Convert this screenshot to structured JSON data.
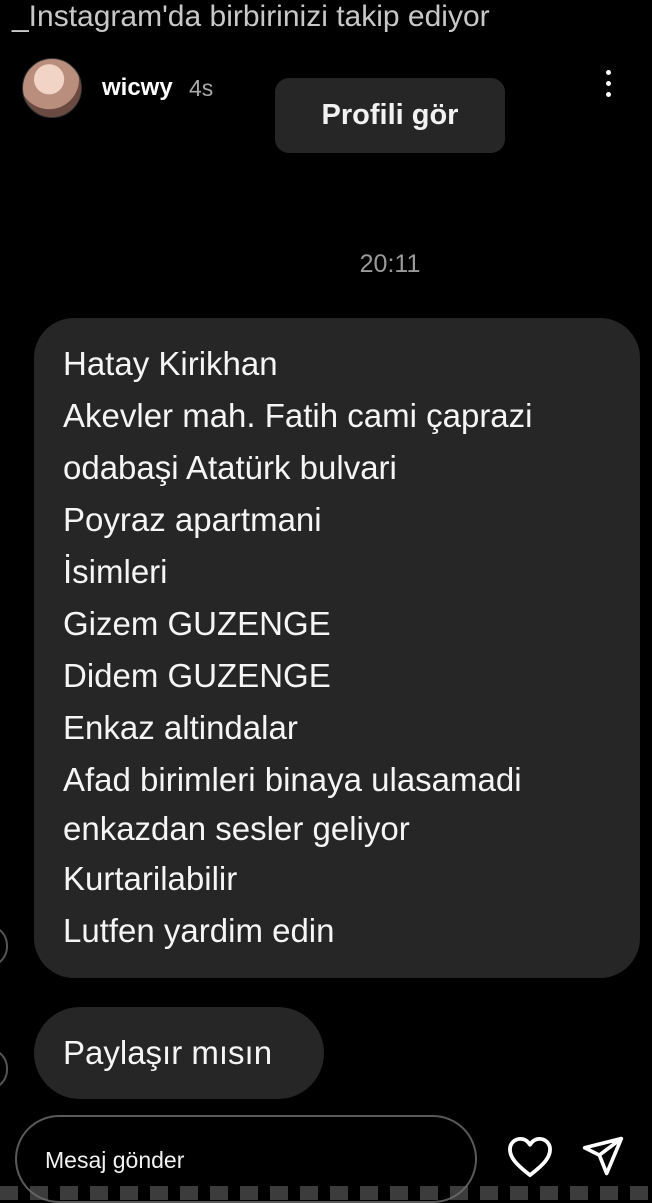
{
  "top_banner": {
    "text": "_Instagram'da birbirinizi takip ediyor"
  },
  "header": {
    "username": "wicwy",
    "time_ago": "4s",
    "more_icon": "more-vertical-icon",
    "profile_button": "Profili gör"
  },
  "chat": {
    "timestamp": "20:11",
    "message_lines": [
      "Hatay Kirikhan",
      "Akevler mah. Fatih cami çaprazi",
      "odabaşi Atatürk bulvari",
      "Poyraz apartmani",
      "İsimleri",
      "Gizem GUZENGE",
      "Didem GUZENGE",
      "Enkaz altindalar",
      "Afad birimleri binaya ulasamadi",
      "enkazdan sesler geliyor",
      "Kurtarilabilir",
      "Lutfen yardim edin"
    ],
    "second_message": "Paylaşır mısın"
  },
  "footer": {
    "input_placeholder": "Mesaj gönder",
    "heart_icon": "heart-icon",
    "send_icon": "send-icon"
  }
}
